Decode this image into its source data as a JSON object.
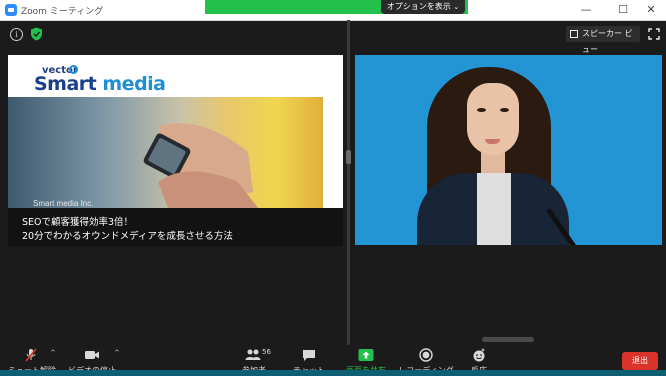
{
  "window": {
    "title": "Zoom ミーティング",
    "options_label": "オプションを表示",
    "minimize": "—",
    "maximize": "☐",
    "close": "✕"
  },
  "top_bar": {
    "info_glyph": "i",
    "speaker_view_label": "スピーカー ビュー"
  },
  "shared_screen": {
    "logo_top": "vector",
    "logo_main_a": "Smart",
    "logo_main_b": " media",
    "photo_caption": "Smart media Inc.",
    "title_line1": "SEOで顧客獲得効率3倍！",
    "title_line2": "20分でわかるオウンドメディアを成長させる方法"
  },
  "toolbar": {
    "mute_label": "ミュート解除",
    "video_label": "ビデオの停止",
    "participants_label": "参加者",
    "participants_count": "56",
    "chat_label": "チャット",
    "share_label": "画面を共有",
    "record_label": "レコーディング",
    "reactions_label": "反応",
    "leave_label": "退出",
    "caret": "^"
  },
  "colors": {
    "share_green": "#23c14c",
    "leave_red": "#d9332b",
    "video_bg": "#2495d4"
  },
  "icons": [
    "zoom-app-icon",
    "info-icon",
    "shield-icon",
    "grid-icon",
    "fullscreen-icon",
    "mic-muted-icon",
    "video-camera-icon",
    "participants-icon",
    "chat-icon",
    "share-screen-icon",
    "record-icon",
    "reactions-icon"
  ]
}
